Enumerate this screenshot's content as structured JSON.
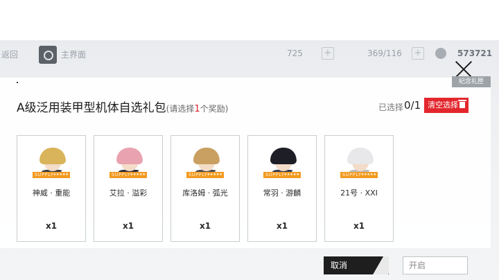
{
  "hud": {
    "back_label": "返回",
    "home_label": "主界面",
    "res1_value": "725",
    "res2_value": "369/116",
    "res3_value": "573721",
    "plus_label": "+"
  },
  "dialog": {
    "title": "A级泛用装甲型机体自选礼包",
    "hint_prefix": "(请选择",
    "hint_count": "1",
    "hint_suffix": "个奖励)",
    "selected_label": "已选择",
    "selected_count": "0/1",
    "clear_label": "清空选择",
    "souvenir_tag": "纪念礼匣",
    "cancel_label": "取消",
    "open_label": "开启"
  },
  "rewards": [
    {
      "name": "神威 · 重能",
      "qty": "x1",
      "rank": "SUPPLY",
      "hair": "#d9b45a",
      "body": "#3a3e44"
    },
    {
      "name": "艾拉 · 溢彩",
      "qty": "x1",
      "rank": "SUPPLY",
      "hair": "#e9a3b0",
      "body": "#2c2c3a"
    },
    {
      "name": "库洛姆 · 弧光",
      "qty": "x1",
      "rank": "SUPPLY",
      "hair": "#c9a062",
      "body": "#4a4d52"
    },
    {
      "name": "常羽 · 游麟",
      "qty": "x1",
      "rank": "SUPPLY",
      "hair": "#1e1e26",
      "body": "#2f3b55"
    },
    {
      "name": "21号 · XXI",
      "qty": "x1",
      "rank": "SUPPLY",
      "hair": "#e8e8ea",
      "body": "#b9bcc0"
    }
  ],
  "colors": {
    "accent_red": "#e3262d",
    "rank_orange": "#f29a1f"
  }
}
